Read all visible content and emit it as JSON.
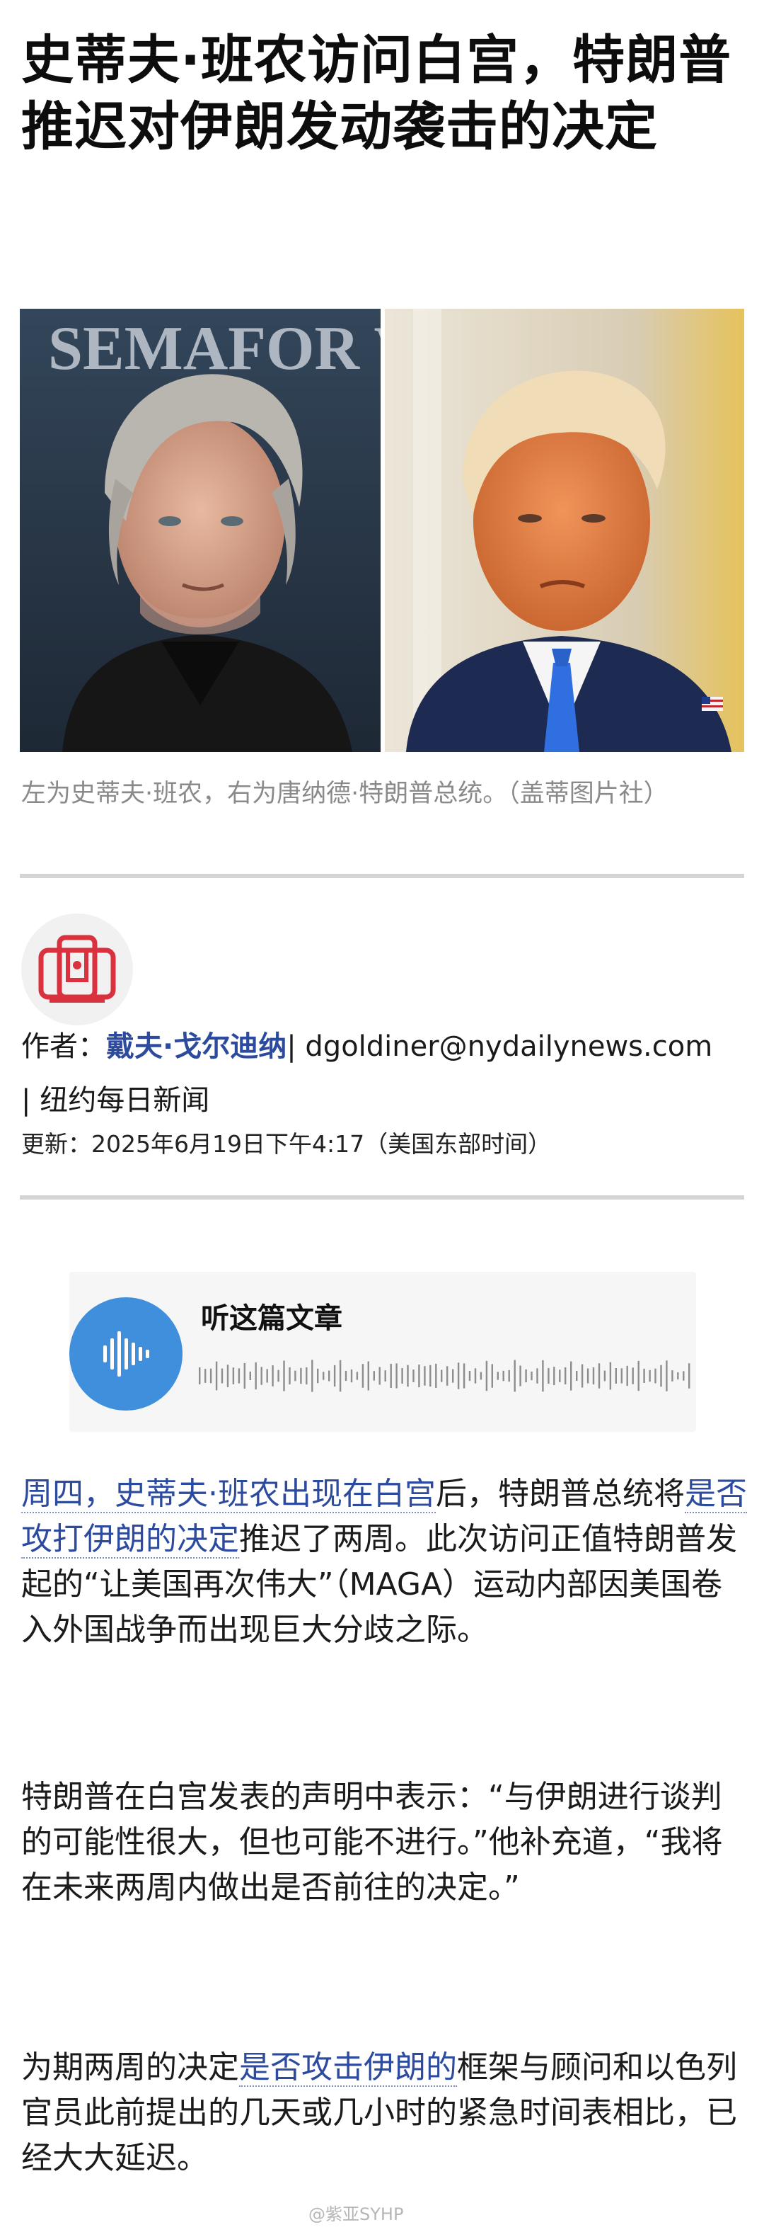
{
  "article": {
    "headline": "史蒂夫·班农访问白宫，特朗普推迟对伊朗发动袭击的决定",
    "photo_caption": "左为史蒂夫·班农，右为唐纳德·特朗普总统。（盖蒂图片社）",
    "left_photo_backdrop_text": "SEMAFOR World Economy Summit"
  },
  "byline": {
    "author_prefix": "作者：",
    "author_name": "戴夫·戈尔迪纳",
    "separator1": "| ",
    "email": "dgoldiner@nydailynews.com",
    "separator2": "| ",
    "publication": "纽约每日新闻",
    "updated": "更新：2025年6月19日下午4:17（美国东部时间）"
  },
  "audio": {
    "title": "听这篇文章",
    "accent_color": "#3f8fdc"
  },
  "paragraphs": {
    "p1": {
      "link1": "周四，史蒂夫·班农出现在白宫",
      "text1": "后，特朗普总统将",
      "link2": "是否攻打伊朗的决定",
      "text2": "推迟了两周。此次访问正值特朗普发起的“让美国再次伟大”（MAGA）运动内部因美国卷入外国战争而出现巨大分歧之际。"
    },
    "p2": {
      "text": "特朗普在白宫发表的声明中表示：“与伊朗进行谈判的可能性很大，但也可能不进行。”他补充道，“我将在未来两周内做出是否前往的决定。”"
    },
    "p3": {
      "text1": "为期两周的决定",
      "link": "是否攻击伊朗的",
      "text2": "框架与顾问和以色列官员此前提出的几天或几小时的紧急时间表相比，已经大大延迟。"
    }
  },
  "watermark": "@紫亚SYHP",
  "colors": {
    "link": "#2c4a9e",
    "rule": "#d4d4d4",
    "caption": "#8a8a8a"
  }
}
